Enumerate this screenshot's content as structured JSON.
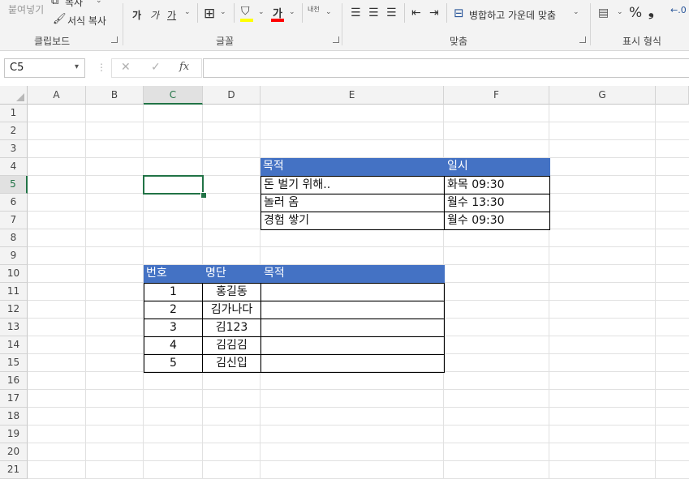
{
  "ribbon": {
    "clipboard": {
      "paste_label": "붙여넣기",
      "copy_label": "복사",
      "format_painter_label": "서식 복사",
      "group_label": "클립보드"
    },
    "font": {
      "bold_label": "가",
      "italic_label": "가",
      "underline_label": "가",
      "font_color_label": "가",
      "phonetic_label": "내천",
      "group_label": "글꼴"
    },
    "alignment": {
      "merge_center_label": "병합하고 가운데 맞춤",
      "group_label": "맞춤"
    },
    "number": {
      "percent_label": "%",
      "comma_label": "❟",
      "group_label": "표시 형식"
    }
  },
  "formula_bar": {
    "name_box": "C5",
    "cancel_icon": "✕",
    "enter_icon": "✓",
    "fx_label": "fx",
    "value": ""
  },
  "columns": [
    "A",
    "B",
    "C",
    "D",
    "E",
    "F",
    "G"
  ],
  "rows": [
    "1",
    "2",
    "3",
    "4",
    "5",
    "6",
    "7",
    "8",
    "9",
    "10",
    "11",
    "12",
    "13",
    "14",
    "15",
    "16",
    "17",
    "18",
    "19",
    "20",
    "21"
  ],
  "selected_cell": "C5",
  "table1": {
    "headers": [
      "목적",
      "일시"
    ],
    "rows": [
      [
        "돈 벌기 위해..",
        "화목 09:30"
      ],
      [
        "놀러 옴",
        "월수 13:30"
      ],
      [
        "경험 쌓기",
        "월수 09:30"
      ]
    ]
  },
  "table2": {
    "headers": [
      "번호",
      "명단",
      "목적"
    ],
    "rows": [
      [
        "1",
        "홍길동",
        ""
      ],
      [
        "2",
        "김가나다",
        ""
      ],
      [
        "3",
        "김123",
        ""
      ],
      [
        "4",
        "김김김",
        ""
      ],
      [
        "5",
        "김신입",
        ""
      ]
    ]
  },
  "colors": {
    "header_fill": "#4472c4",
    "accent": "#217346"
  }
}
